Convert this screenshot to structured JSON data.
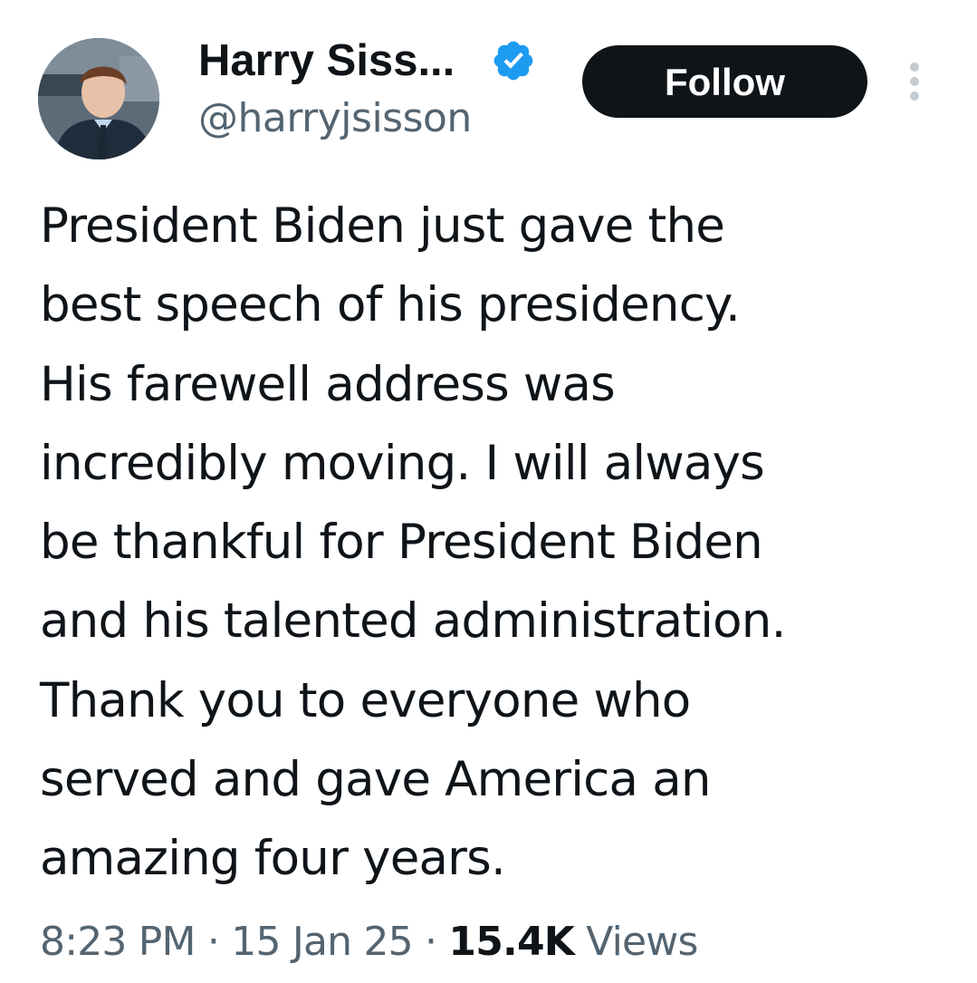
{
  "author": {
    "display_name": "Harry Siss...",
    "handle": "@harryjsisson",
    "verified_icon": "verified-badge-icon",
    "avatar_icon": "profile-photo"
  },
  "follow_button": {
    "label": "Follow"
  },
  "more_menu": {
    "icon": "more-vertical-icon"
  },
  "tweet": {
    "lines": [
      "President Biden just gave the",
      "best speech of his presidency.",
      "His farewell address was",
      "incredibly moving. I will always",
      "be thankful for President Biden",
      "and his talented administration.",
      "Thank you to everyone who",
      "served and gave America an",
      "amazing four years."
    ]
  },
  "meta": {
    "time": "8:23 PM",
    "separator": "·",
    "date": "15 Jan 25",
    "views_count": "15.4K",
    "views_label": "Views"
  },
  "colors": {
    "text_primary": "#0f1419",
    "text_secondary": "#536471",
    "verified_blue": "#1d9bf0",
    "button_bg": "#0f1419",
    "background": "#ffffff"
  }
}
